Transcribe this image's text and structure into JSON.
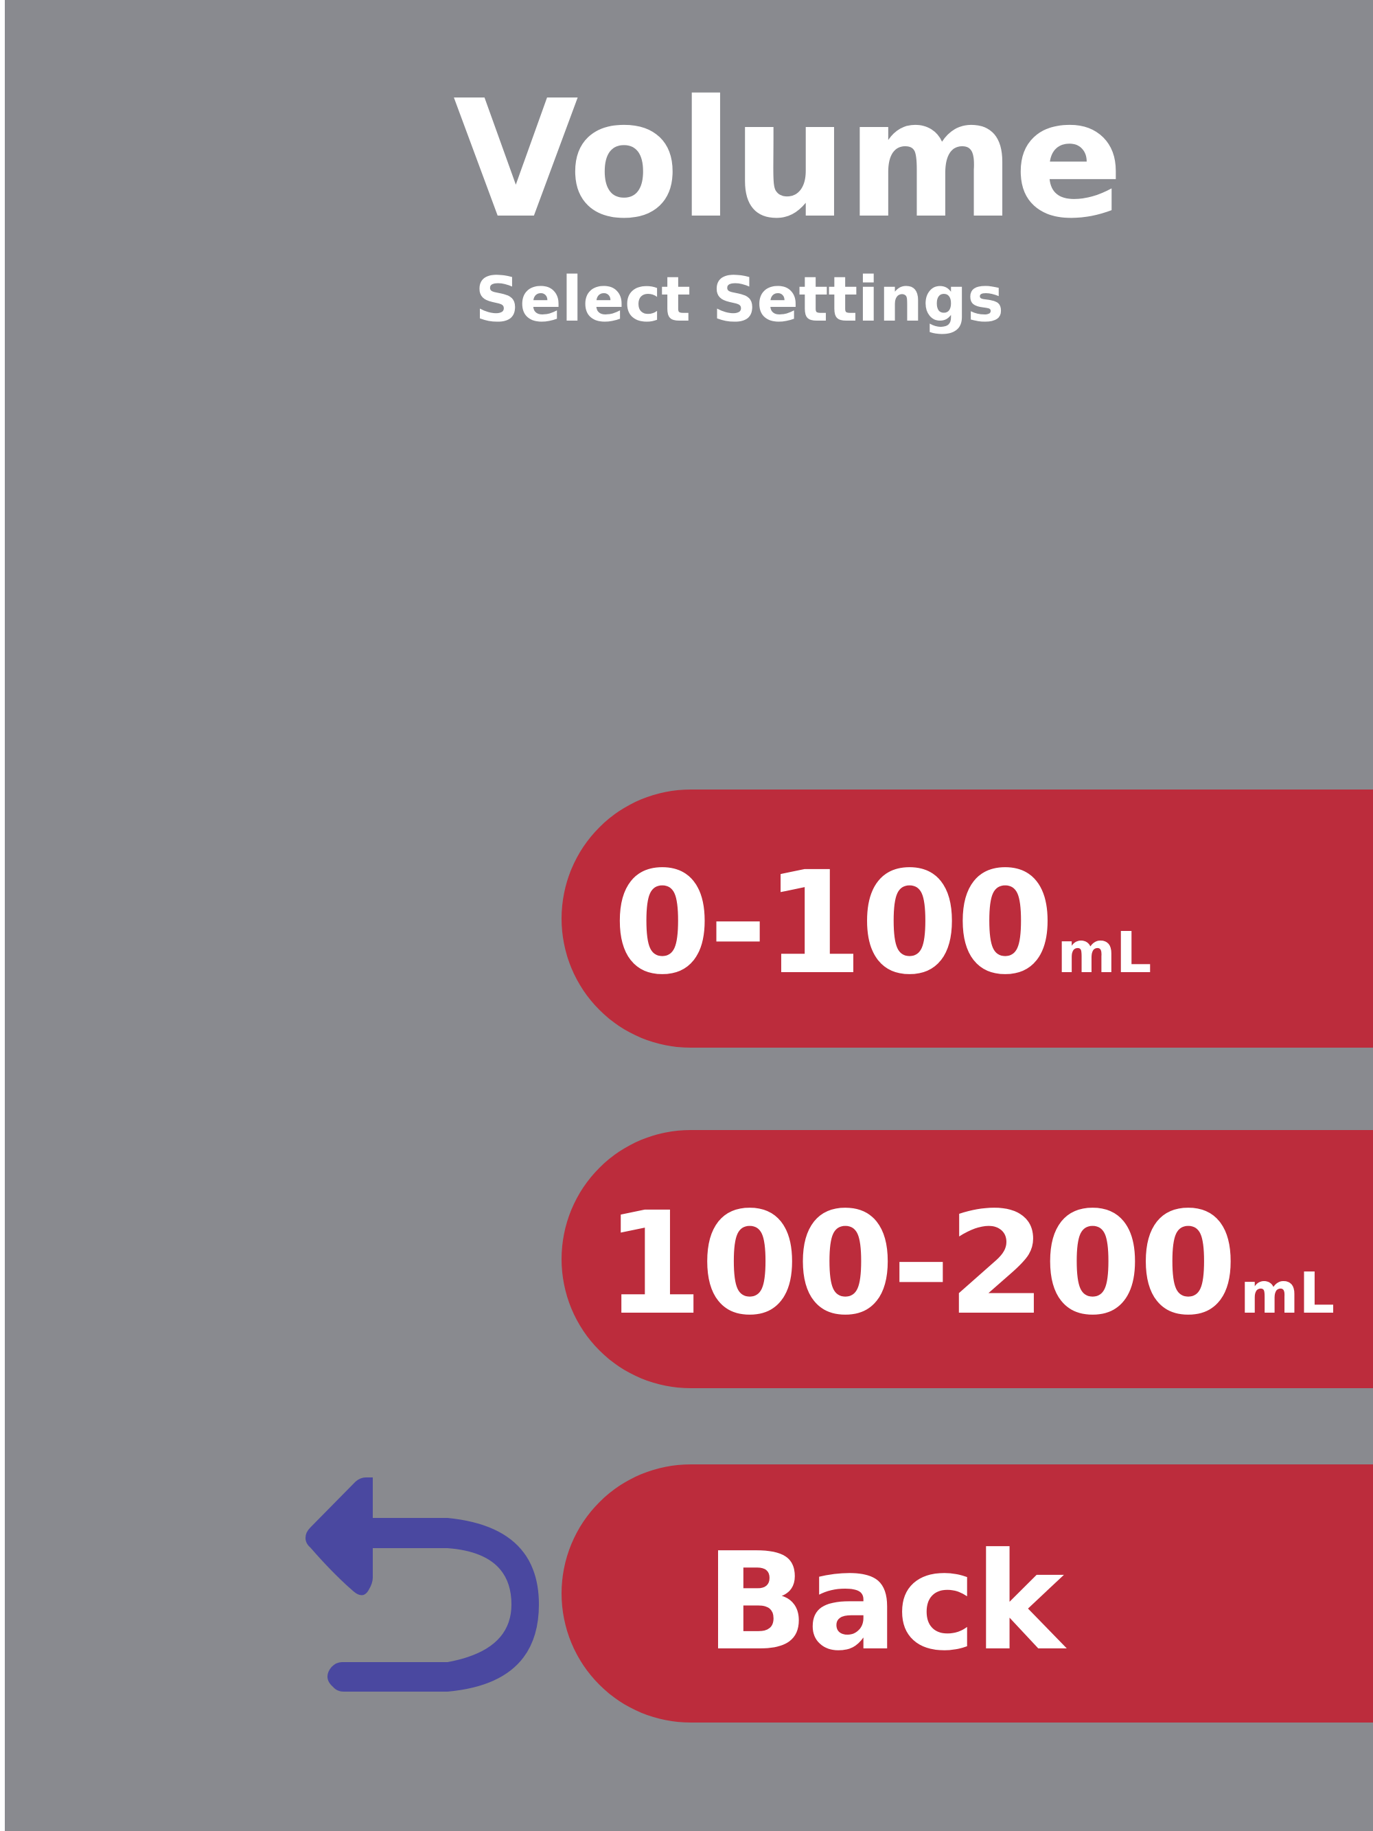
{
  "header": {
    "title": "Volume",
    "subtitle": "Select Settings"
  },
  "options": [
    {
      "range": "0-100",
      "unit": "mL"
    },
    {
      "range": "100-200",
      "unit": "mL"
    }
  ],
  "back": {
    "label": "Back",
    "icon": "return-arrow-icon"
  },
  "colors": {
    "background": "#898a8f",
    "button": "#bc2c3c",
    "text": "#ffffff",
    "back_icon": "#4a48a0"
  }
}
